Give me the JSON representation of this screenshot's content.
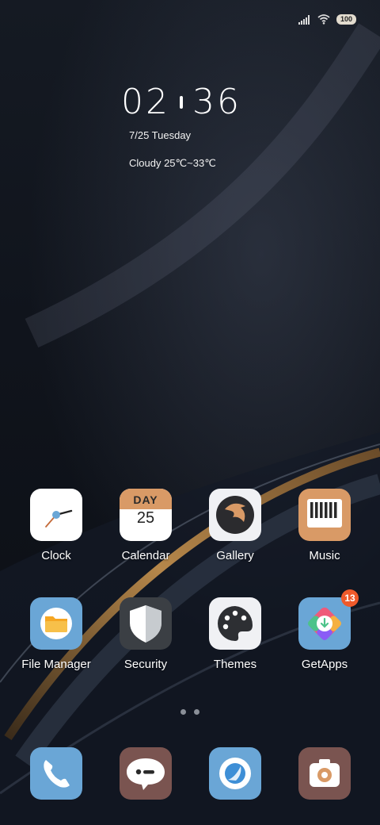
{
  "status_bar": {
    "battery": "100",
    "signal_icon": "signal-icon",
    "wifi_icon": "wifi-icon"
  },
  "clock_widget": {
    "hours": "02",
    "minutes": "36",
    "date": "7/25 Tuesday",
    "weather": "Cloudy 25℃~33℃"
  },
  "apps": {
    "clock": {
      "label": "Clock",
      "icon": "clock-icon"
    },
    "calendar": {
      "label": "Calendar",
      "icon": "calendar-icon",
      "day_text": "DAY",
      "day_number": "25"
    },
    "gallery": {
      "label": "Gallery",
      "icon": "eagle-icon"
    },
    "music": {
      "label": "Music",
      "icon": "piano-icon"
    },
    "file_manager": {
      "label": "File Manager",
      "icon": "folder-icon"
    },
    "security": {
      "label": "Security",
      "icon": "shield-icon"
    },
    "themes": {
      "label": "Themes",
      "icon": "palette-icon"
    },
    "getapps": {
      "label": "GetApps",
      "icon": "getapps-icon",
      "badge": "13"
    }
  },
  "dock": [
    {
      "name": "phone",
      "icon": "phone-icon"
    },
    {
      "name": "messages",
      "icon": "message-icon"
    },
    {
      "name": "browser",
      "icon": "browser-icon"
    },
    {
      "name": "camera",
      "icon": "camera-icon"
    }
  ],
  "page_indicator": {
    "pages": 2,
    "current": 1
  },
  "colors": {
    "accent_gold": "#b6874a",
    "badge": "#ef5a2b",
    "icon_blue": "#6aa6d6",
    "icon_brown": "#7a5450",
    "icon_orange": "#d99a66"
  }
}
